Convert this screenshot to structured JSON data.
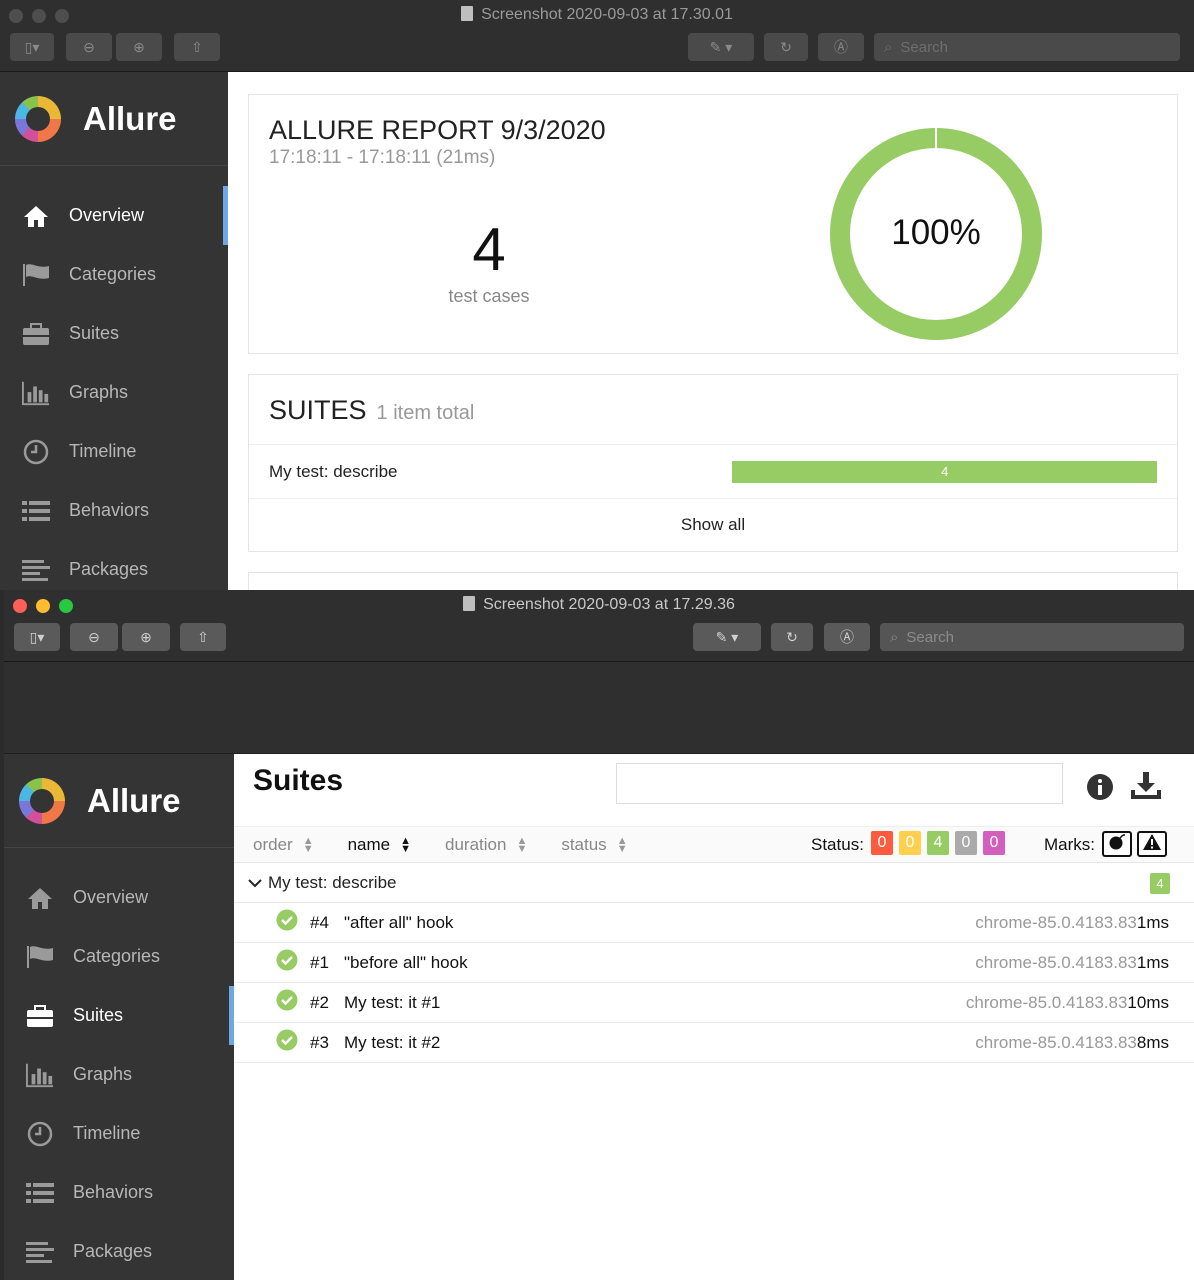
{
  "window1": {
    "title": "Screenshot 2020-09-03 at 17.30.01",
    "search_placeholder": "Search",
    "brand": "Allure",
    "nav": [
      {
        "label": "Overview",
        "icon": "home-icon"
      },
      {
        "label": "Categories",
        "icon": "flag-icon"
      },
      {
        "label": "Suites",
        "icon": "briefcase-icon"
      },
      {
        "label": "Graphs",
        "icon": "bar-chart-icon"
      },
      {
        "label": "Timeline",
        "icon": "clock-icon"
      },
      {
        "label": "Behaviors",
        "icon": "list-icon"
      },
      {
        "label": "Packages",
        "icon": "align-left-icon"
      }
    ],
    "active_nav": "Overview",
    "report": {
      "title": "ALLURE REPORT 9/3/2020",
      "time_range": "17:18:11 - 17:18:11 (21ms)",
      "test_count": "4",
      "test_count_label": "test cases",
      "percent": "100%",
      "passed_fraction": 1.0,
      "passed_color": "#97cc64"
    },
    "suites_widget": {
      "title": "SUITES",
      "subtitle": "1 item total",
      "rows": [
        {
          "name": "My test: describe",
          "count": "4"
        }
      ],
      "show_all": "Show all"
    }
  },
  "window2": {
    "title": "Screenshot 2020-09-03 at 17.29.36",
    "search_placeholder": "Search",
    "brand": "Allure",
    "active_nav": "Suites",
    "page_title": "Suites",
    "sort_columns": [
      {
        "label": "order",
        "active": false
      },
      {
        "label": "name",
        "active": true
      },
      {
        "label": "duration",
        "active": false
      },
      {
        "label": "status",
        "active": false
      }
    ],
    "status_label": "Status:",
    "status_badges": [
      {
        "value": "0",
        "color": "#fd5a3e"
      },
      {
        "value": "0",
        "color": "#ffd050"
      },
      {
        "value": "4",
        "color": "#97cc64"
      },
      {
        "value": "0",
        "color": "#aaaaaa"
      },
      {
        "value": "0",
        "color": "#d35ebe"
      }
    ],
    "marks_label": "Marks:",
    "group": {
      "name": "My test: describe",
      "count": "4"
    },
    "tests": [
      {
        "num": "#4",
        "name": "\"after all\" hook",
        "env": "chrome-85.0.4183.83",
        "duration": "1ms"
      },
      {
        "num": "#1",
        "name": "\"before all\" hook",
        "env": "chrome-85.0.4183.83",
        "duration": "1ms"
      },
      {
        "num": "#2",
        "name": "My test: it #1",
        "env": "chrome-85.0.4183.83",
        "duration": "10ms"
      },
      {
        "num": "#3",
        "name": "My test: it #2",
        "env": "chrome-85.0.4183.83",
        "duration": "8ms"
      }
    ]
  }
}
